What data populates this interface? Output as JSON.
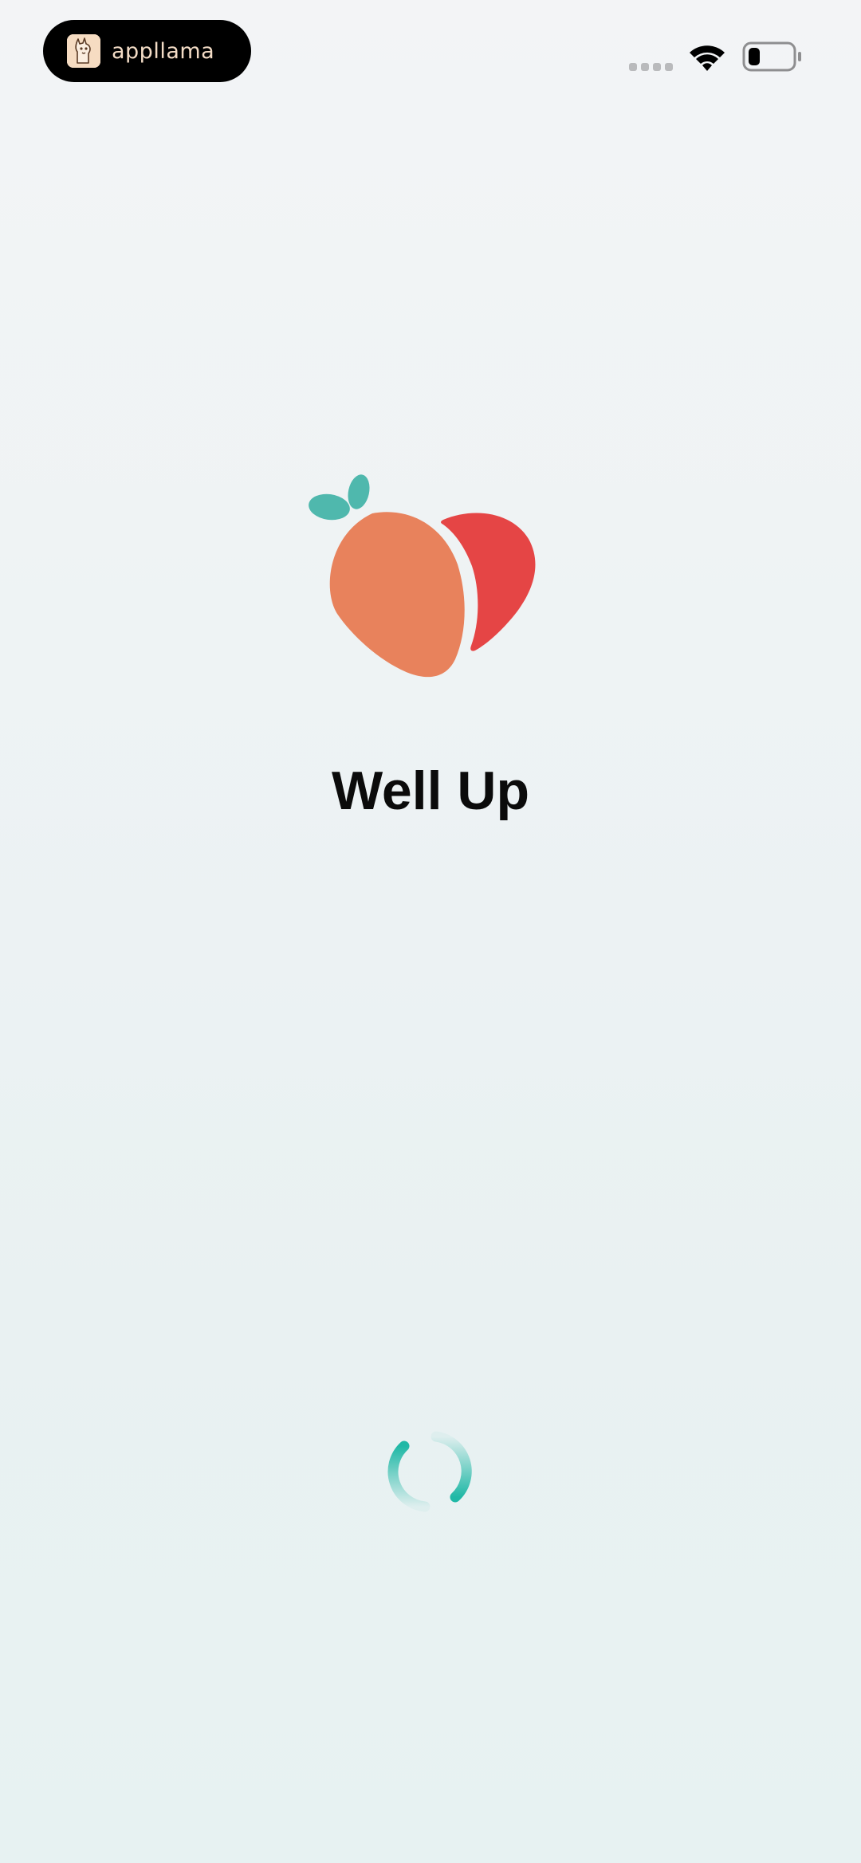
{
  "status_bar": {
    "app_badge_name": "appllama",
    "signal_bars_active": 0,
    "signal_bars_total": 4,
    "wifi": "wifi-icon",
    "battery": "battery-icon"
  },
  "splash": {
    "app_title": "Well Up",
    "logo": "peach-logo-icon",
    "loading": "loading-spinner"
  },
  "colors": {
    "peach_orange": "#e8825c",
    "peach_red": "#e54545",
    "leaf_teal": "#4fb8ad",
    "spinner_teal": "#20b8a6",
    "title": "#0b0b0b"
  }
}
